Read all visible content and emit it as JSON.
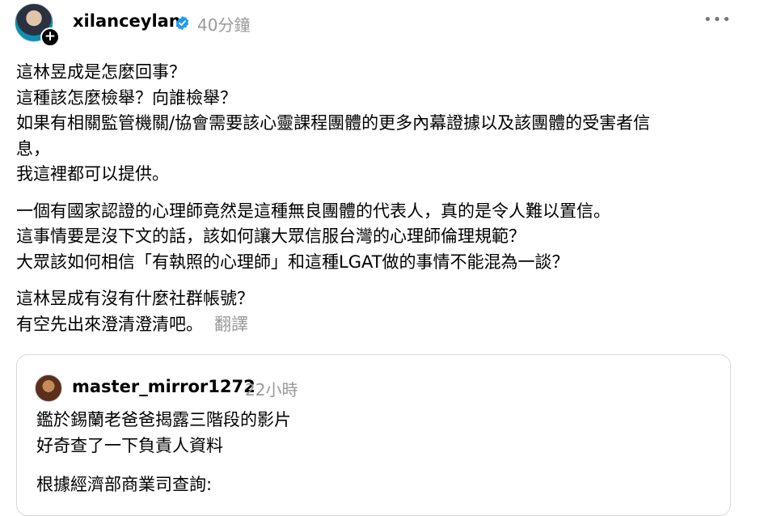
{
  "post": {
    "username": "xilanceylan",
    "verified_icon": "verified-badge-icon",
    "timestamp": "40分鐘",
    "more_icon": "more-horizontal-icon",
    "more_label": "•••",
    "follow_label": "+",
    "paragraphs": [
      [
        "這林昱成是怎麼回事？",
        "這種該怎麼檢舉？向誰檢舉？",
        "如果有相關監管機關/協會需要該心靈課程團體的更多內幕證據以及該團體的受害者信",
        "息，",
        "我這裡都可以提供。"
      ],
      [
        "一個有國家認證的心理師竟然是這種無良團體的代表人，真的是令人難以置信。",
        "這事情要是沒下文的話，該如何讓大眾信服台灣的心理師倫理規範？",
        "大眾該如何相信「有執照的心理師」和這種LGAT做的事情不能混為一談？"
      ],
      [
        "這林昱成有沒有什麼社群帳號？",
        "有空先出來澄清澄清吧。"
      ]
    ],
    "translate_label": "翻譯"
  },
  "quoted": {
    "username": "master_mirror1272",
    "timestamp": "22小時",
    "lines": [
      "鑑於錫蘭老爸爸揭露三階段的影片",
      "好奇查了一下負責人資料"
    ],
    "lines2": [
      "根據經濟部商業司查詢:"
    ]
  },
  "colors": {
    "verified": "#1d9bf0",
    "muted": "#999999",
    "border": "#d9d9d9"
  }
}
